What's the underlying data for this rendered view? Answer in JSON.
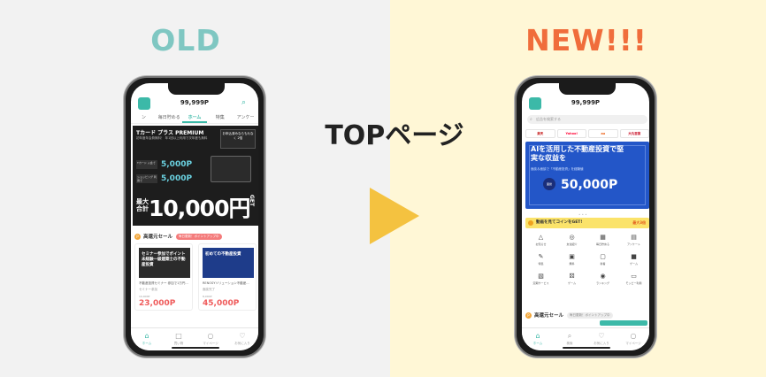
{
  "labels": {
    "old": "OLD",
    "new": "NEW!!!",
    "center_title": "TOPページ"
  },
  "colors": {
    "old_label": "#7fc7c2",
    "new_label": "#f06d3b",
    "arrow": "#f4c240",
    "accent": "#3cb9a8"
  },
  "old_screen": {
    "points": "99,999P",
    "tabs": [
      {
        "label": "ン"
      },
      {
        "label": "毎日貯める"
      },
      {
        "label": "ホーム"
      },
      {
        "label": "特集"
      },
      {
        "label": "アンケー"
      }
    ],
    "banner": {
      "headline": "Tカード プラス PREMIUM",
      "sub": "初年度年会費無料！ 年1回以上利用で次年度も無料",
      "badge": "お申込済みならもれなく 2倍",
      "rows": [
        {
          "tag": "Tカード 入会で",
          "value": "5,000P"
        },
        {
          "tag": "ショッピング 利用で",
          "value": "5,000P"
        }
      ],
      "big_prefix": "最大合計",
      "big_amount": "10,000円",
      "get": "GET"
    },
    "sale": {
      "title": "高還元セール",
      "pill": "毎日更新！ポイントアップ中"
    },
    "cards": [
      {
        "image_text": "セミナー参加でポイント 未経験一級建築士の不動産投資",
        "desc": "不動産投資セミナー 参加で1万円...",
        "sub": "セミナー参加",
        "old_price": "10,000P",
        "price": "23,000P"
      },
      {
        "image_text": "初めての不動産投資",
        "desc": "RENOSYソリューション不動産...",
        "sub": "面談完了",
        "old_price": "8,000P",
        "price": "45,000P"
      }
    ],
    "nav": [
      {
        "label": "ホーム",
        "icon": "home-icon"
      },
      {
        "label": "買い物",
        "icon": "cart-icon"
      },
      {
        "label": "マイページ",
        "icon": "user-icon"
      },
      {
        "label": "お気に入り",
        "icon": "heart-icon"
      }
    ]
  },
  "new_screen": {
    "points": "99,999P",
    "search_placeholder": "広告を検索する",
    "shops": [
      {
        "label": "楽天"
      },
      {
        "label": "Yahoo!"
      },
      {
        "label": "au"
      },
      {
        "label": "大丸百貨"
      }
    ],
    "banner": {
      "title": "AIを活用した不動産投資で堅実な収益を",
      "sub": "面談＆面談で「不動産投資」を経験値",
      "circle": "面談",
      "amount": "50,000P"
    },
    "coin_bar": {
      "text": "動画を見てコインをGET!",
      "right": "最大3倍"
    },
    "grid": [
      {
        "label": "お知らせ",
        "icon": "bell-icon"
      },
      {
        "label": "友達紹介",
        "icon": "friends-icon"
      },
      {
        "label": "毎日貯める",
        "icon": "calendar-icon"
      },
      {
        "label": "アンケート",
        "icon": "survey-icon"
      },
      {
        "label": "特集",
        "icon": "pen-icon"
      },
      {
        "label": "無料",
        "icon": "gift-icon"
      },
      {
        "label": "新着",
        "icon": "new-icon"
      },
      {
        "label": "ゲーム",
        "icon": "game-icon"
      },
      {
        "label": "定期サービス",
        "icon": "service-icon"
      },
      {
        "label": "ゲーム",
        "icon": "dice-icon"
      },
      {
        "label": "ランキング",
        "icon": "ranking-icon"
      },
      {
        "label": "モッピー利用",
        "icon": "controller-icon"
      }
    ],
    "sale": {
      "title": "高還元セール",
      "pill": "毎日更新！ポイントアップ中"
    },
    "nav": [
      {
        "label": "ホーム",
        "icon": "home-icon"
      },
      {
        "label": "検索",
        "icon": "search-icon"
      },
      {
        "label": "お気に入り",
        "icon": "heart-icon"
      },
      {
        "label": "マイページ",
        "icon": "user-icon"
      }
    ]
  }
}
